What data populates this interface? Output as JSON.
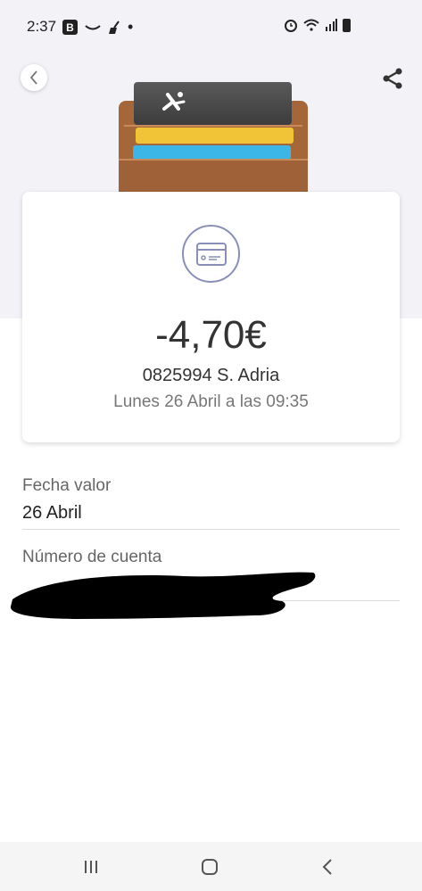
{
  "status_bar": {
    "time": "2:37",
    "left_icons": [
      "b-badge-icon",
      "amazon-smile-icon",
      "broom-icon",
      "dot-icon"
    ],
    "b_badge": "B",
    "right_icons": [
      "alarm-icon",
      "wifi-icon",
      "signal-icon",
      "battery-icon"
    ]
  },
  "header": {
    "back_icon": "chevron-left-icon",
    "share_icon": "share-icon"
  },
  "transaction": {
    "icon": "credit-card-icon",
    "amount": "-4,70€",
    "merchant": "0825994 S. Adria",
    "datetime": "Lunes 26 Abril a las 09:35"
  },
  "details": {
    "fecha_valor": {
      "label": "Fecha valor",
      "value": "26 Abril"
    },
    "numero_cuenta": {
      "label": "Número de cuenta",
      "value": ""
    }
  },
  "nav_bar": {
    "items": [
      "recent-apps-icon",
      "home-icon",
      "back-icon"
    ]
  },
  "colors": {
    "top_background": "#f2f2f7",
    "card_icon_ring": "#8a8fb8",
    "wallet_brown": "#a5673a",
    "card_yellow": "#f1c438",
    "card_blue": "#3cb6e6"
  }
}
